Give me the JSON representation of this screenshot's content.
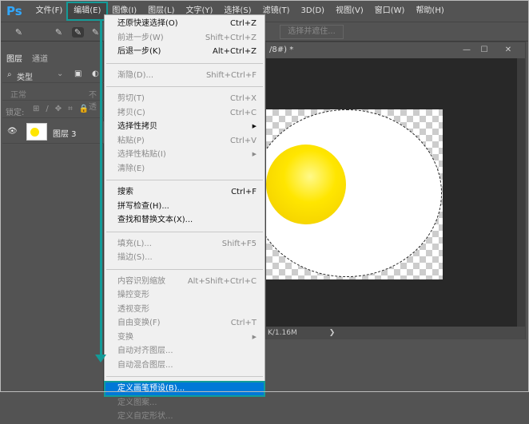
{
  "app": {
    "logo": "Ps",
    "menus": [
      "文件(F)",
      "编辑(E)",
      "图像(I)",
      "图层(L)",
      "文字(Y)",
      "选择(S)",
      "滤镜(T)",
      "3D(D)",
      "视图(V)",
      "窗口(W)",
      "帮助(H)"
    ],
    "active_menu": "编辑(E)"
  },
  "options": {
    "refine_button": "选择并遮住..."
  },
  "layers_panel": {
    "tabs": [
      "图层",
      "通道"
    ],
    "filter_label": "类型",
    "blend_mode": "正常",
    "opacity_label": "不透",
    "lock_label": "锁定:",
    "layer_name": "图层 3"
  },
  "document": {
    "title_fragment": "/8#) *",
    "status": "K/1.16M",
    "status_arrow": "❯",
    "window_buttons": [
      "—",
      "☐",
      "✕"
    ]
  },
  "edit_menu": {
    "groups": [
      [
        {
          "label": "还原快速选择(O)",
          "shortcut": "Ctrl+Z",
          "enabled": true
        },
        {
          "label": "前进一步(W)",
          "shortcut": "Shift+Ctrl+Z",
          "enabled": false
        },
        {
          "label": "后退一步(K)",
          "shortcut": "Alt+Ctrl+Z",
          "enabled": true
        }
      ],
      [
        {
          "label": "渐隐(D)...",
          "shortcut": "Shift+Ctrl+F",
          "enabled": false
        }
      ],
      [
        {
          "label": "剪切(T)",
          "shortcut": "Ctrl+X",
          "enabled": false
        },
        {
          "label": "拷贝(C)",
          "shortcut": "Ctrl+C",
          "enabled": false
        },
        {
          "label": "选择性拷贝",
          "shortcut": "▶",
          "enabled": true
        },
        {
          "label": "粘贴(P)",
          "shortcut": "Ctrl+V",
          "enabled": false
        },
        {
          "label": "选择性粘贴(I)",
          "shortcut": "▶",
          "enabled": false
        },
        {
          "label": "清除(E)",
          "shortcut": "",
          "enabled": false
        }
      ],
      [
        {
          "label": "搜索",
          "shortcut": "Ctrl+F",
          "enabled": true
        },
        {
          "label": "拼写检查(H)...",
          "shortcut": "",
          "enabled": true
        },
        {
          "label": "查找和替换文本(X)...",
          "shortcut": "",
          "enabled": true
        }
      ],
      [
        {
          "label": "填充(L)...",
          "shortcut": "Shift+F5",
          "enabled": false
        },
        {
          "label": "描边(S)...",
          "shortcut": "",
          "enabled": false
        }
      ],
      [
        {
          "label": "内容识别缩放",
          "shortcut": "Alt+Shift+Ctrl+C",
          "enabled": false
        },
        {
          "label": "操控变形",
          "shortcut": "",
          "enabled": false
        },
        {
          "label": "透视变形",
          "shortcut": "",
          "enabled": false
        },
        {
          "label": "自由变换(F)",
          "shortcut": "Ctrl+T",
          "enabled": false
        },
        {
          "label": "变换",
          "shortcut": "▶",
          "enabled": false
        },
        {
          "label": "自动对齐图层...",
          "shortcut": "",
          "enabled": false
        },
        {
          "label": "自动混合图层...",
          "shortcut": "",
          "enabled": false
        }
      ],
      [
        {
          "label": "定义画笔预设(B)...",
          "shortcut": "",
          "enabled": true,
          "highlighted": true
        },
        {
          "label": "定义图案...",
          "shortcut": "",
          "enabled": false
        },
        {
          "label": "定义自定形状...",
          "shortcut": "",
          "enabled": false
        }
      ]
    ]
  },
  "colors": {
    "accent": "#139b98",
    "highlight": "#0078d7",
    "yolk": "#ffe600"
  }
}
